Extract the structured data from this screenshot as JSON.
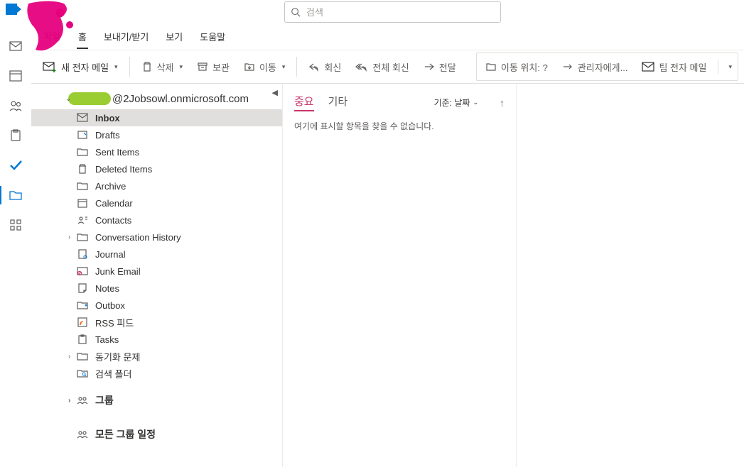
{
  "search": {
    "placeholder": "검색"
  },
  "menu": {
    "file": "파일",
    "home": "홈",
    "sendreceive": "보내기/받기",
    "view": "보기",
    "help": "도움말"
  },
  "ribbon": {
    "new_mail": "새 전자 메일",
    "delete": "삭제",
    "archive": "보관",
    "move": "이동",
    "reply": "회신",
    "reply_all": "전체 회신",
    "forward": "전달",
    "move_to": "이동 위치: ?",
    "to_manager": "관리자에게...",
    "team_mail": "팀 전자 메일"
  },
  "account": {
    "domain": "@2Jobsowl.onmicrosoft.com"
  },
  "folders": {
    "inbox": "Inbox",
    "drafts": "Drafts",
    "sent": "Sent Items",
    "deleted": "Deleted Items",
    "archive": "Archive",
    "calendar": "Calendar",
    "contacts": "Contacts",
    "conv": "Conversation History",
    "journal": "Journal",
    "junk": "Junk Email",
    "notes": "Notes",
    "outbox": "Outbox",
    "rss": "RSS 피드",
    "tasks": "Tasks",
    "sync": "동기화 문제",
    "searchf": "검색 폴더"
  },
  "groups": {
    "label": "그룹",
    "all_cal": "모든 그룹 일정"
  },
  "msglist": {
    "focused": "중요",
    "other": "기타",
    "sort": "기준: 날짜",
    "empty": "여기에 표시할 항목을 찾을 수 없습니다."
  }
}
